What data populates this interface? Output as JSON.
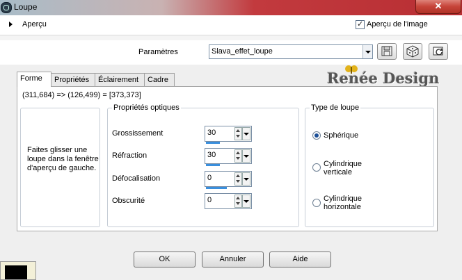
{
  "window": {
    "title": "Loupe",
    "close_label": "✕"
  },
  "preview": {
    "label": "Aperçu",
    "image_preview_label": "Aperçu de l'image",
    "image_preview_checked": true
  },
  "params": {
    "label": "Paramètres",
    "preset_value": "Slava_effet_loupe"
  },
  "tabs": [
    {
      "label": "Forme",
      "active": true
    },
    {
      "label": "Propriétés",
      "active": false
    },
    {
      "label": "Éclairement",
      "active": false
    },
    {
      "label": "Cadre",
      "active": false
    }
  ],
  "coords": "(311,684) => (126,499) = [373,373]",
  "instructions": "Faites glisser une loupe dans la fenêtre d'aperçu de gauche.",
  "optical": {
    "title": "Propriétés optiques",
    "fields": [
      {
        "label": "Grossissement",
        "value": "30"
      },
      {
        "label": "Réfraction",
        "value": "30"
      },
      {
        "label": "Défocalisation",
        "value": "0"
      },
      {
        "label": "Obscurité",
        "value": "0"
      }
    ]
  },
  "loupe_type": {
    "title": "Type de loupe",
    "options": [
      "Sphérique",
      "Cylindrique verticale",
      "Cylindrique horizontale"
    ],
    "selected": "Sphérique"
  },
  "buttons": {
    "ok": "OK",
    "cancel": "Annuler",
    "help": "Aide"
  },
  "watermark": "Renée Design",
  "icons": [
    "save-icon",
    "randomize-icon",
    "reset-icon"
  ]
}
